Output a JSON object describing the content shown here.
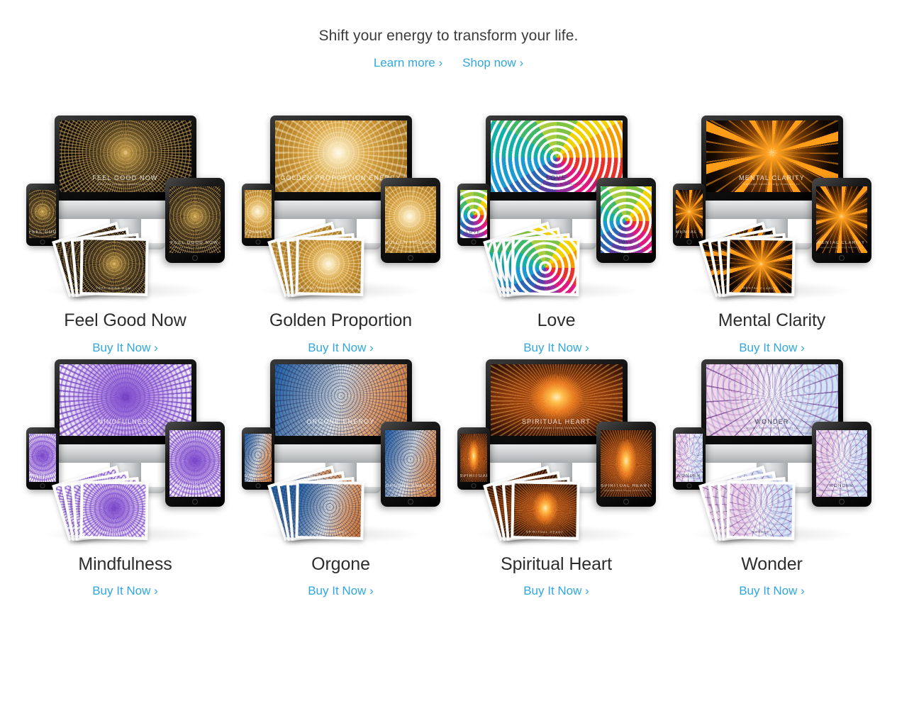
{
  "hero": {
    "tagline": "Shift your energy to transform your life.",
    "links": [
      {
        "label": "Learn more ›",
        "name": "learn-more-link"
      },
      {
        "label": "Shop now ›",
        "name": "shop-now-link"
      }
    ]
  },
  "colors": {
    "link": "#31a7dd",
    "title": "#2d2d2d",
    "tagline": "#3b3b3b",
    "background": "#ffffff"
  },
  "buy_label": "Buy It Now ›",
  "products": [
    {
      "title": "Feel Good Now",
      "buy_label": "Buy It Now ›",
      "artwork_text": "FEEL GOOD NOW",
      "artwork_subtext": "Shift your energy to transform your life",
      "theme": "t-feelgood",
      "label_tone": "light"
    },
    {
      "title": "Golden Proportion",
      "buy_label": "Buy It Now ›",
      "artwork_text": "GOLDEN PROPORTION ENERGY",
      "artwork_subtext": "Copyright Subtle Energy Sciences LLC",
      "theme": "t-golden",
      "label_tone": "light"
    },
    {
      "title": "Love",
      "buy_label": "Buy It Now ›",
      "artwork_text": "LOVE",
      "artwork_subtext": "Copyright Subtle Energy Sciences LLC",
      "theme": "t-love",
      "label_tone": "dark"
    },
    {
      "title": "Mental Clarity",
      "buy_label": "Buy It Now ›",
      "artwork_text": "MENTAL CLARITY",
      "artwork_subtext": "Copyright Subtle Energy Sciences LLC",
      "theme": "t-mental",
      "label_tone": "light"
    },
    {
      "title": "Mindfulness",
      "buy_label": "Buy It Now ›",
      "artwork_text": "MINDFULNESS",
      "artwork_subtext": "Copyright Subtle Energy Sciences LLC",
      "theme": "t-mind",
      "label_tone": "light"
    },
    {
      "title": "Orgone",
      "buy_label": "Buy It Now ›",
      "artwork_text": "ORGONE ENERGY",
      "artwork_subtext": "Copyright Subtle Energy Sciences LLC",
      "theme": "t-orgone",
      "label_tone": "light"
    },
    {
      "title": "Spiritual Heart",
      "buy_label": "Buy It Now ›",
      "artwork_text": "SPIRITUAL HEART",
      "artwork_subtext": "Copyright Subtle Energy Sciences LLC",
      "theme": "t-heart",
      "label_tone": "light"
    },
    {
      "title": "Wonder",
      "buy_label": "Buy It Now ›",
      "artwork_text": "WONDER",
      "artwork_subtext": "Copyright Subtle Energy Sciences LLC",
      "theme": "t-wonder",
      "label_tone": "dark"
    }
  ]
}
